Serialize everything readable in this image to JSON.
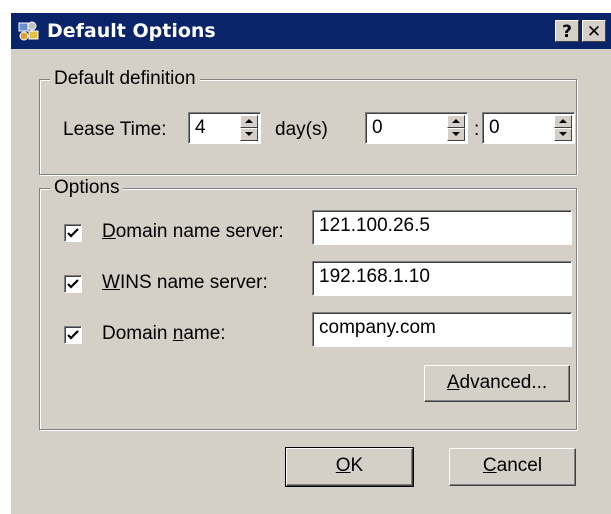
{
  "window": {
    "title": "Default Options",
    "help_label": "?",
    "close_label": "✕"
  },
  "default_definition": {
    "legend": "Default definition",
    "lease_label": "Lease Time:",
    "days": "4",
    "days_unit": "day(s)",
    "hours": "0",
    "separator": ":",
    "minutes": "0"
  },
  "options": {
    "legend": "Options",
    "dns": {
      "checked": true,
      "label_u": "D",
      "label_rest": "omain name server:",
      "value": "121.100.26.5"
    },
    "wins": {
      "checked": true,
      "label_u": "W",
      "label_rest": "INS name server:",
      "value": "192.168.1.10"
    },
    "domain": {
      "checked": true,
      "label_pre": "Domain ",
      "label_u": "n",
      "label_rest": "ame:",
      "value": "company.com"
    },
    "advanced": {
      "label_u": "A",
      "label_rest": "dvanced..."
    }
  },
  "buttons": {
    "ok": {
      "label_u": "O",
      "label_rest": "K"
    },
    "cancel": {
      "label_u": "C",
      "label_rest": "ancel"
    }
  },
  "icons": {
    "title": "network-options-icon"
  }
}
